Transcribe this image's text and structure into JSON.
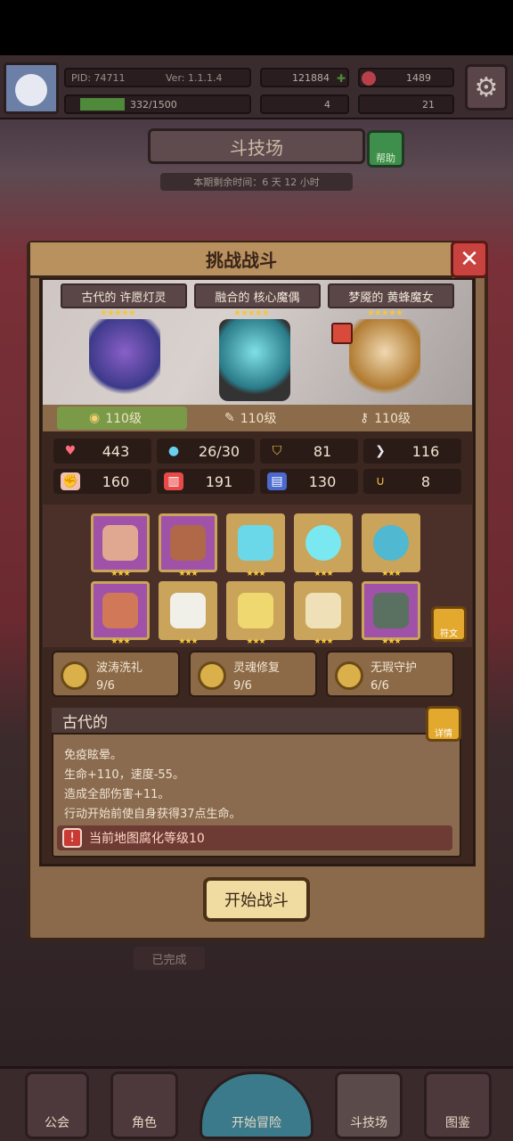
{
  "header": {
    "pid": "PID: 74711",
    "version": "Ver: 1.1.1.4",
    "exp": "332/1500",
    "gold": "121884",
    "gems": "1489",
    "clover": "4",
    "ticket": "21"
  },
  "arena": {
    "title": "斗技场",
    "help": "帮助",
    "season": "本期剩余时间：6 天 12 小时"
  },
  "modal": {
    "title": "挑战战斗",
    "close": "✕",
    "characters": [
      {
        "name": "古代的 许愿灯灵",
        "stars": "★★★★★"
      },
      {
        "name": "融合的 核心魔偶",
        "stars": "★★★★★"
      },
      {
        "name": "梦魇的 黄蜂魔女",
        "stars": "★★★★★"
      }
    ],
    "levels": [
      "110级",
      "110级",
      "110级"
    ],
    "stats": [
      {
        "icon": "heart-icon",
        "value": "443"
      },
      {
        "icon": "mana-drop-icon",
        "value": "26/30"
      },
      {
        "icon": "shield-icon",
        "value": "81"
      },
      {
        "icon": "wing-icon",
        "value": "116"
      },
      {
        "icon": "fist-icon",
        "value": "160"
      },
      {
        "icon": "book-icon",
        "value": "191"
      },
      {
        "icon": "scroll-icon",
        "value": "130"
      },
      {
        "icon": "horseshoe-icon",
        "value": "8"
      }
    ],
    "items": [
      {
        "name": "staff-item",
        "stars": "★★★"
      },
      {
        "name": "urn-item",
        "stars": "★★★"
      },
      {
        "name": "heart-amulet-item",
        "stars": "★★★"
      },
      {
        "name": "crystal-orb-item",
        "stars": "★★★"
      },
      {
        "name": "ring-item",
        "stars": "★★★"
      },
      {
        "name": "dragon-helm-item",
        "stars": "★★★"
      },
      {
        "name": "angel-armor-item",
        "stars": "★★★"
      },
      {
        "name": "scroll-item",
        "stars": "★★★"
      },
      {
        "name": "belt-item",
        "stars": "★★★"
      },
      {
        "name": "boots-item",
        "stars": "★★★"
      }
    ],
    "rune_label": "符文",
    "sets": [
      {
        "name": "波涛洗礼",
        "count": "9/6"
      },
      {
        "name": "灵魂修复",
        "count": "9/6"
      },
      {
        "name": "无瑕守护",
        "count": "6/6"
      }
    ],
    "desc_title": "古代的",
    "detail_label": "详情",
    "desc_lines": [
      "免疫眩晕。",
      "生命+110，速度-55。",
      "造成全部伤害+11。",
      "行动开始前使自身获得37点生命。"
    ],
    "warning": "当前地图腐化等级10",
    "start": "开始战斗"
  },
  "background": {
    "completed": "已完成"
  },
  "nav": [
    "公会",
    "角色",
    "开始冒险",
    "斗技场",
    "图鉴"
  ],
  "colors": {
    "accent": "#c9a45a",
    "danger": "#c8423f",
    "purple_tile": "#a052a8",
    "gold_tile": "#c9a45a"
  }
}
